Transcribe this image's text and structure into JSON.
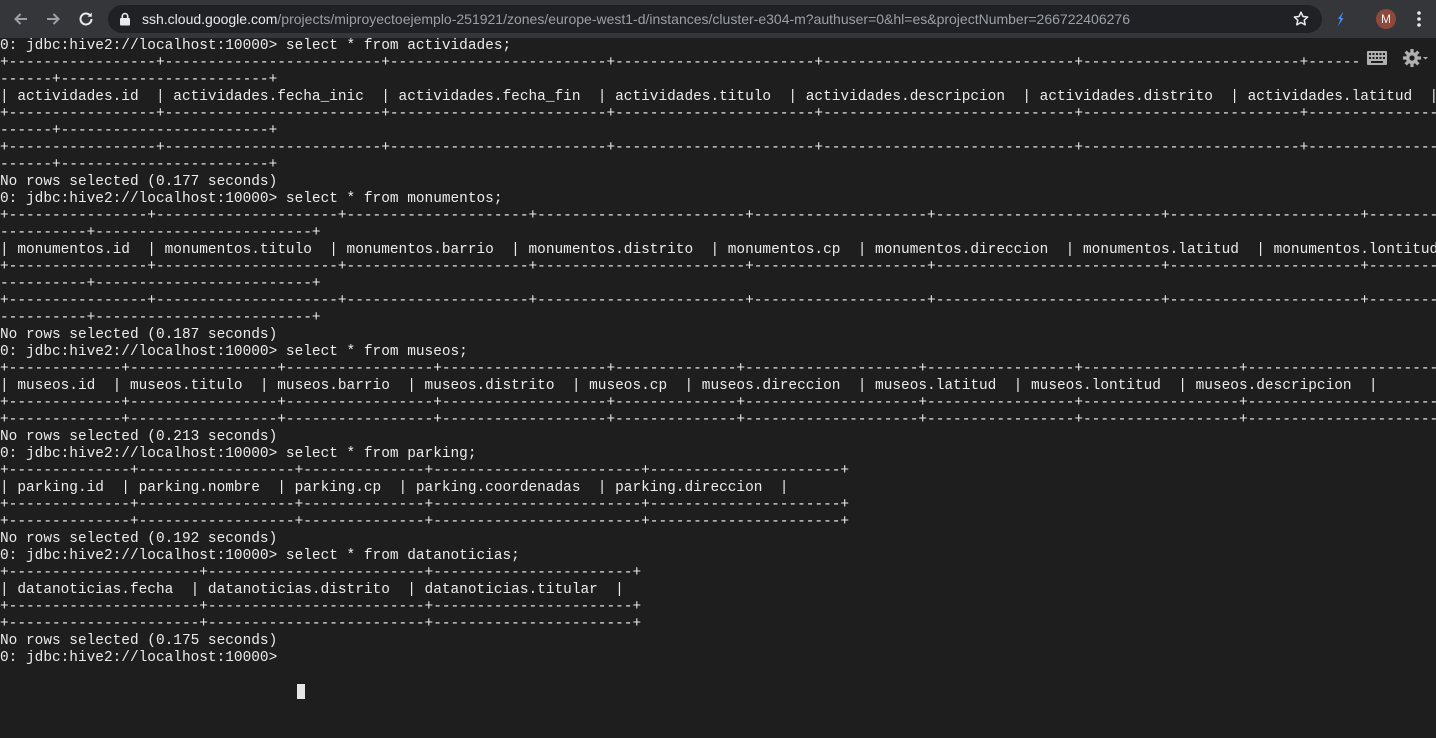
{
  "browser": {
    "url_host": "ssh.cloud.google.com",
    "url_path": "/projects/miproyectoejemplo-251921/zones/europe-west1-d/instances/cluster-e304-m?authuser=0&hl=es&projectNumber=266722406276",
    "avatar_letter": "M",
    "icons": [
      "back-arrow-icon",
      "forward-arrow-icon",
      "reload-icon",
      "lock-icon",
      "star-icon",
      "extension-icon",
      "kebab-menu-icon"
    ]
  },
  "terminal": {
    "lines": [
      "0: jdbc:hive2://localhost:10000> select * from actividades;",
      "+-----------------+-------------------------+-------------------------+-----------------------+-----------------------------+-------------------------+-----------------------+-----------------",
      "------+------------------------+",
      "| actividades.id  | actividades.fecha_inic  | actividades.fecha_fin  | actividades.titulo  | actividades.descripcion  | actividades.distrito  | actividades.latitud  | actividades.longitud  |",
      "+-----------------+-------------------------+-------------------------+-----------------------+-----------------------------+-------------------------+-----------------------+-----------------",
      "------+------------------------+",
      "+-----------------+-------------------------+-------------------------+-----------------------+-----------------------------+-------------------------+-----------------------+-----------------",
      "------+------------------------+",
      "No rows selected (0.177 seconds)",
      "0: jdbc:hive2://localhost:10000> select * from monumentos;",
      "+----------------+---------------------+---------------------+------------------------+--------------------+--------------------------+----------------------+------------------",
      "----------+-------------------------+",
      "| monumentos.id  | monumentos.titulo  | monumentos.barrio  | monumentos.distrito  | monumentos.cp  | monumentos.direccion  | monumentos.latitud  | monumentos.lontitud  | monumentos.descripcion  |",
      "+----------------+---------------------+---------------------+------------------------+--------------------+--------------------------+----------------------+------------------",
      "----------+-------------------------+",
      "+----------------+---------------------+---------------------+------------------------+--------------------+--------------------------+----------------------+------------------",
      "----------+-------------------------+",
      "No rows selected (0.187 seconds)",
      "0: jdbc:hive2://localhost:10000> select * from museos;",
      "+-------------+-----------------+-----------------+-------------------+--------------+--------------------+-----------------+------------------+----------------------+",
      "| museos.id  | museos.titulo  | museos.barrio  | museos.distrito  | museos.cp  | museos.direccion  | museos.latitud  | museos.lontitud  | museos.descripcion  |",
      "+-------------+-----------------+-----------------+-------------------+--------------+--------------------+-----------------+------------------+----------------------+",
      "+-------------+-----------------+-----------------+-------------------+--------------+--------------------+-----------------+------------------+----------------------+",
      "No rows selected (0.213 seconds)",
      "0: jdbc:hive2://localhost:10000> select * from parking;",
      "+--------------+------------------+--------------+------------------------+----------------------+",
      "| parking.id  | parking.nombre  | parking.cp  | parking.coordenadas  | parking.direccion  |",
      "+--------------+------------------+--------------+------------------------+----------------------+",
      "+--------------+------------------+--------------+------------------------+----------------------+",
      "No rows selected (0.192 seconds)",
      "0: jdbc:hive2://localhost:10000> select * from datanoticias;",
      "+----------------------+-------------------------+-----------------------+",
      "| datanoticias.fecha  | datanoticias.distrito  | datanoticias.titular  |",
      "+----------------------+-------------------------+-----------------------+",
      "+----------------------+-------------------------+-----------------------+",
      "No rows selected (0.175 seconds)",
      "0: jdbc:hive2://localhost:10000> "
    ],
    "icons": [
      "keyboard-icon",
      "settings-gear-icon"
    ]
  }
}
